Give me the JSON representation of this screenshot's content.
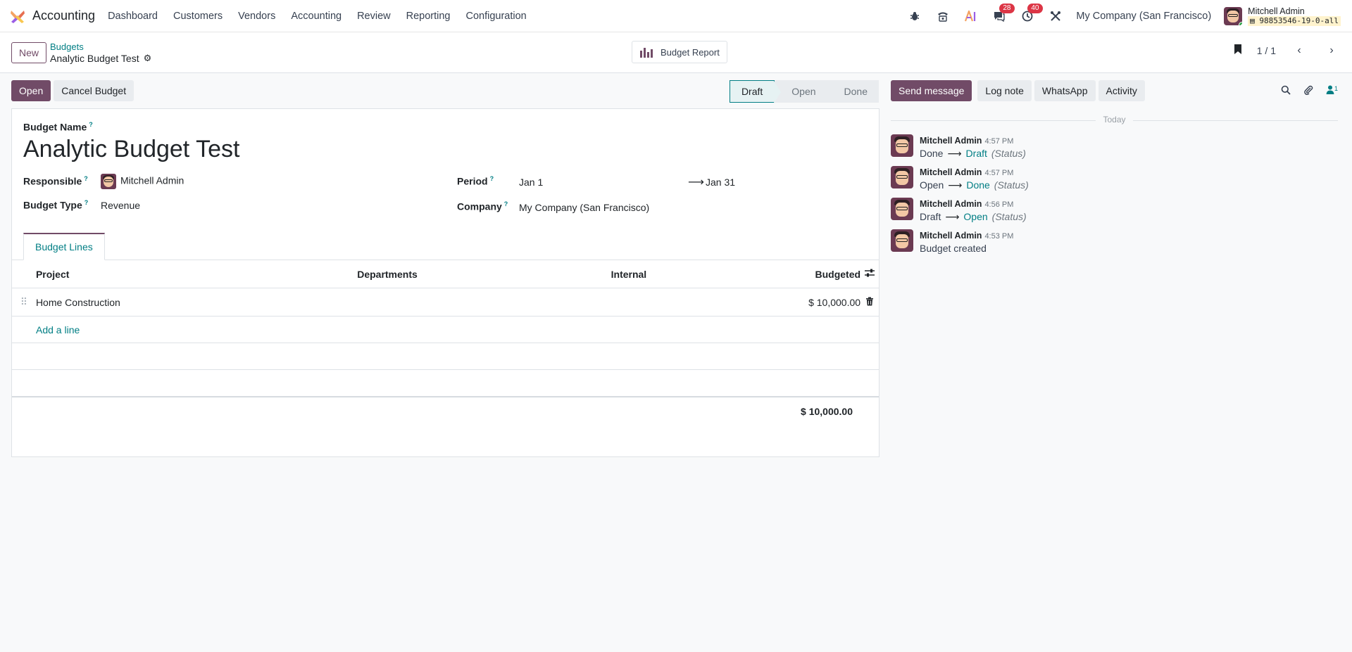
{
  "app": {
    "name": "Accounting"
  },
  "nav": [
    "Dashboard",
    "Customers",
    "Vendors",
    "Accounting",
    "Review",
    "Reporting",
    "Configuration"
  ],
  "systray": {
    "messages_count": "28",
    "activities_count": "40",
    "company": "My Company (San Francisco)",
    "user_name": "Mitchell Admin",
    "db_name": "98853546-19-0-all"
  },
  "control": {
    "new_label": "New",
    "breadcrumb_parent": "Budgets",
    "breadcrumb_current": "Analytic Budget Test",
    "report_label": "Budget Report",
    "pager": "1 / 1"
  },
  "statusbar": {
    "open_label": "Open",
    "cancel_label": "Cancel Budget",
    "stages": [
      "Draft",
      "Open",
      "Done"
    ],
    "active_stage": "Draft"
  },
  "form": {
    "name_label": "Budget Name",
    "name": "Analytic Budget Test",
    "responsible_label": "Responsible",
    "responsible": "Mitchell Admin",
    "type_label": "Budget Type",
    "type": "Revenue",
    "period_label": "Period",
    "period_start": "Jan 1",
    "period_end": "Jan 31",
    "company_label": "Company",
    "company": "My Company (San Francisco)",
    "tab_label": "Budget Lines",
    "columns": [
      "Project",
      "Departments",
      "Internal",
      "Budgeted"
    ],
    "lines": [
      {
        "project": "Home Construction",
        "departments": "",
        "internal": "",
        "budgeted": "$ 10,000.00"
      }
    ],
    "add_line": "Add a line",
    "total": "$ 10,000.00"
  },
  "chatter": {
    "send_label": "Send message",
    "log_label": "Log note",
    "whatsapp_label": "WhatsApp",
    "activity_label": "Activity",
    "followers_count": "1",
    "date_separator": "Today",
    "messages": [
      {
        "author": "Mitchell Admin",
        "time": "4:57 PM",
        "old": "Done",
        "new": "Draft",
        "field": "(Status)"
      },
      {
        "author": "Mitchell Admin",
        "time": "4:57 PM",
        "old": "Open",
        "new": "Done",
        "field": "(Status)"
      },
      {
        "author": "Mitchell Admin",
        "time": "4:56 PM",
        "old": "Draft",
        "new": "Open",
        "field": "(Status)"
      },
      {
        "author": "Mitchell Admin",
        "time": "4:53 PM",
        "body": "Budget created"
      }
    ]
  }
}
